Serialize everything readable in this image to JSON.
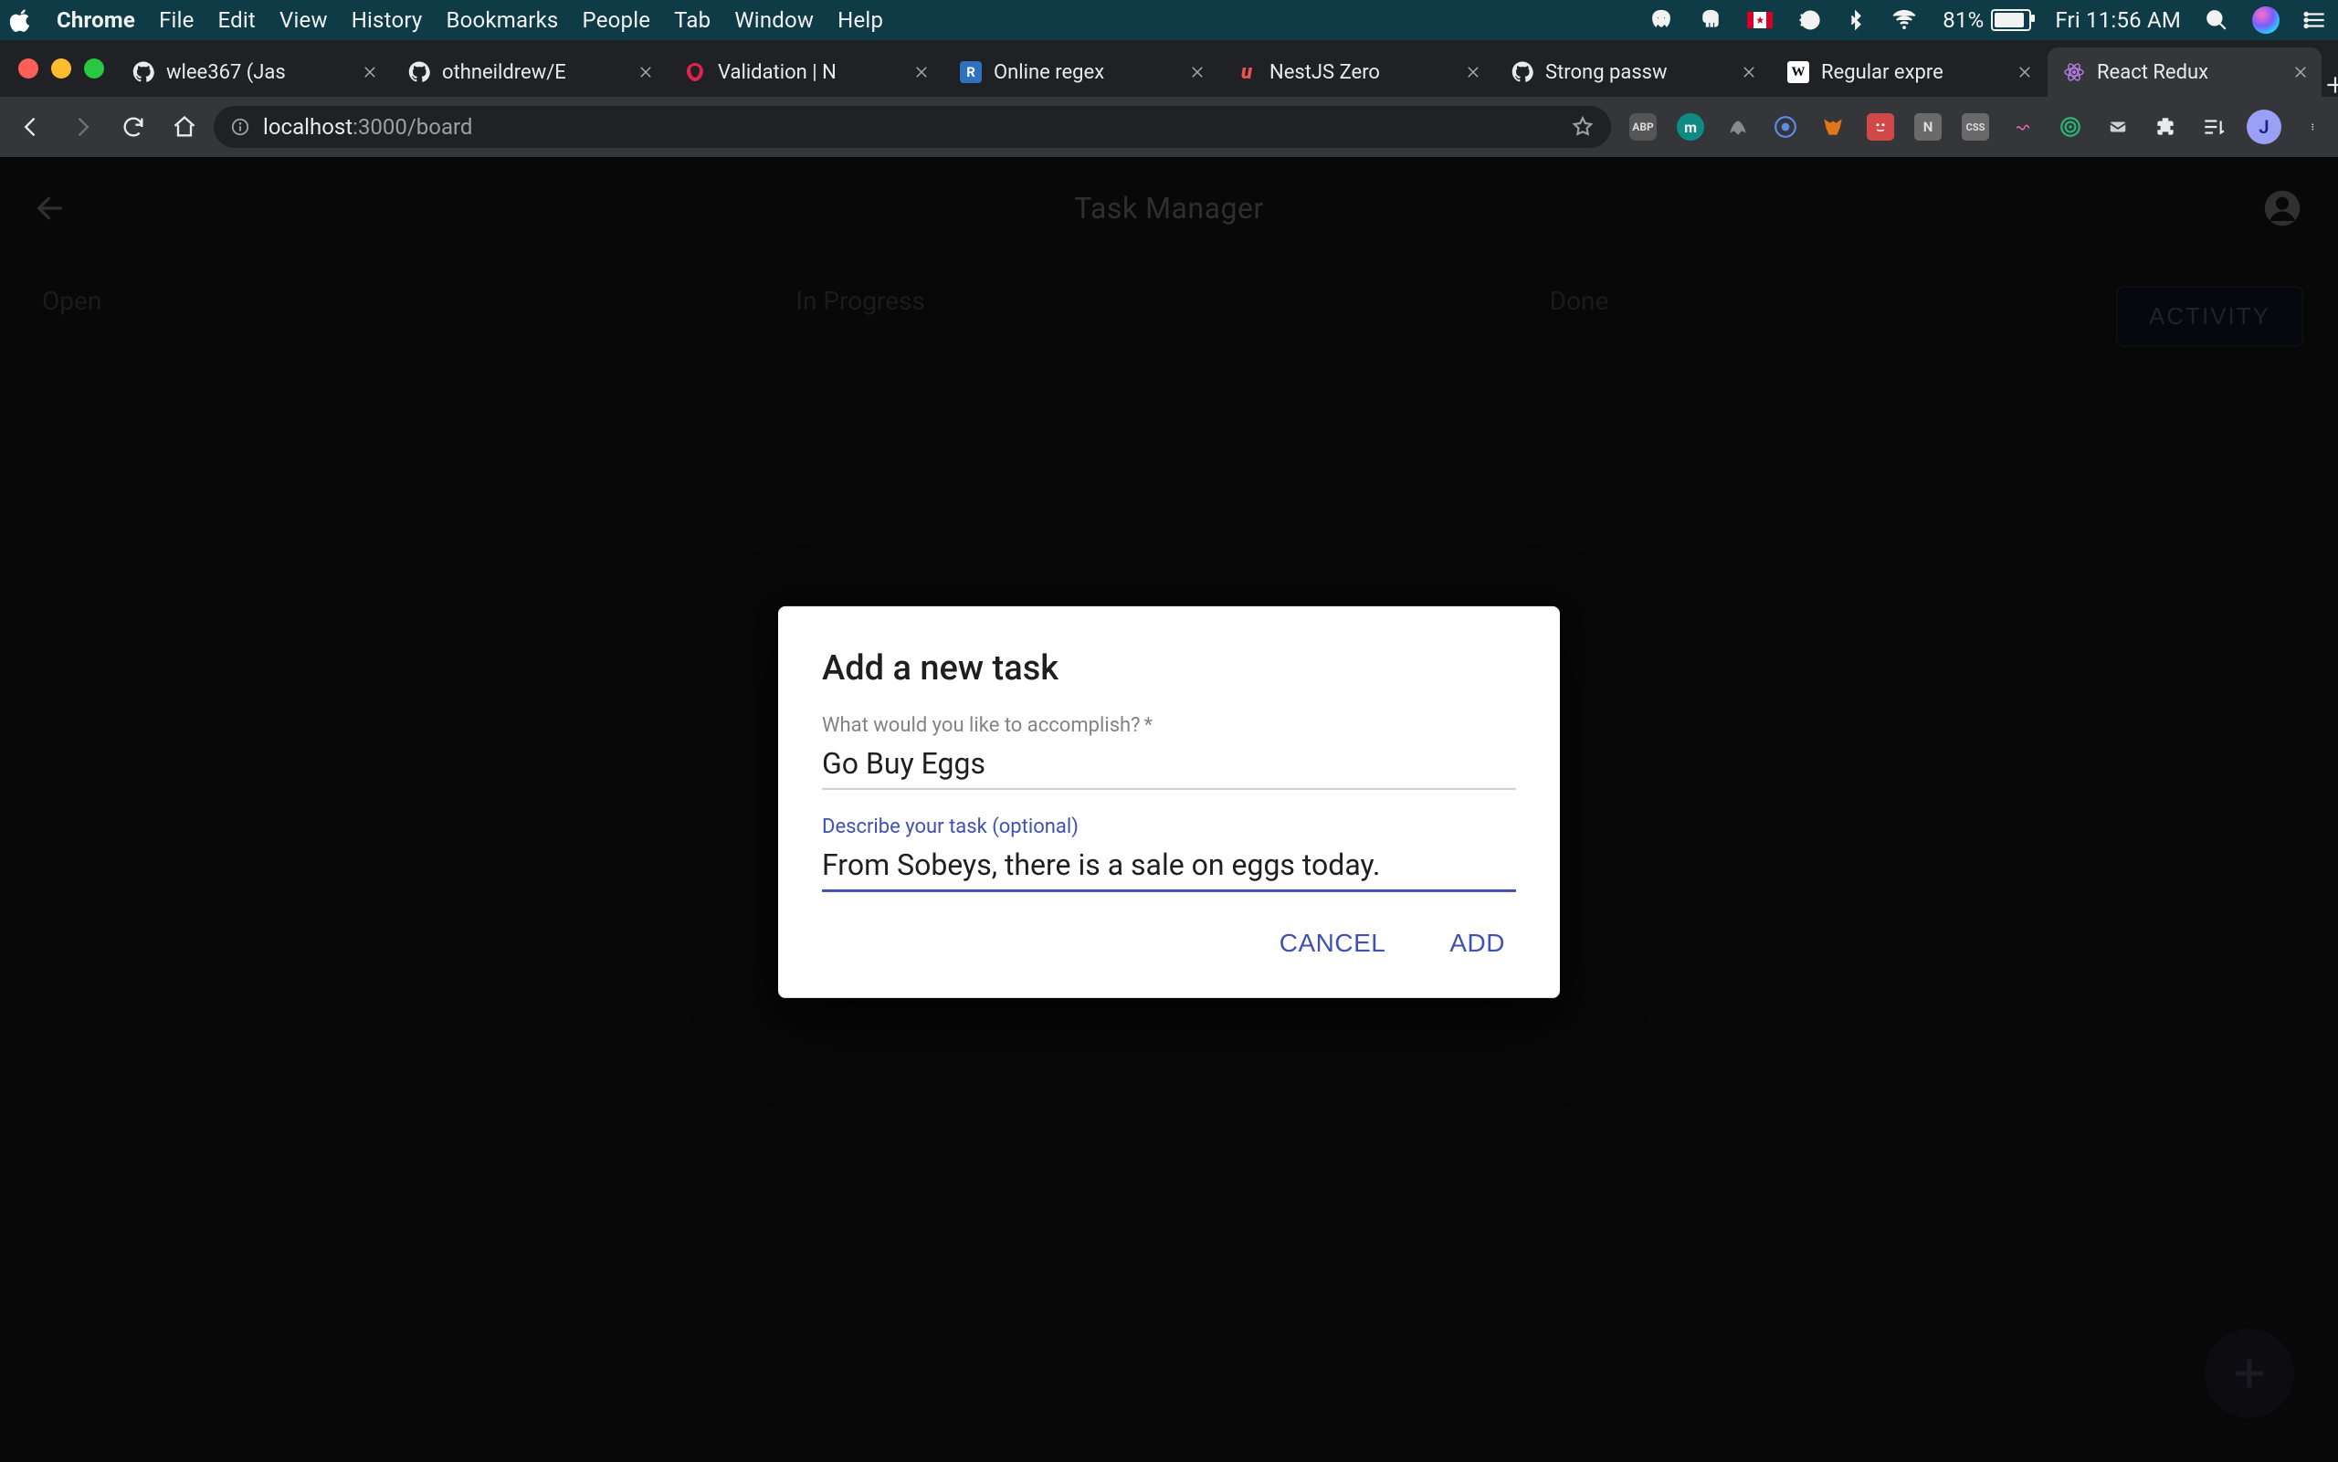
{
  "menubar": {
    "app": "Chrome",
    "items": [
      "File",
      "Edit",
      "View",
      "History",
      "Bookmarks",
      "People",
      "Tab",
      "Window",
      "Help"
    ],
    "battery_pct": "81%",
    "clock": "Fri 11:56 AM"
  },
  "browser": {
    "tabs": [
      {
        "favicon": "github",
        "title": "wlee367 (Jas"
      },
      {
        "favicon": "github",
        "title": "othneildrew/E"
      },
      {
        "favicon": "nest",
        "title": "Validation | N"
      },
      {
        "favicon": "rcube",
        "title": "Online regex"
      },
      {
        "favicon": "udemy",
        "title": "NestJS Zero"
      },
      {
        "favicon": "github",
        "title": "Strong passw"
      },
      {
        "favicon": "wiki",
        "title": "Regular expre"
      },
      {
        "favicon": "react",
        "title": "React Redux",
        "active": true
      }
    ],
    "url_host": "localhost",
    "url_rest": ":3000/board",
    "avatar_initial": "J"
  },
  "app": {
    "header_title": "Task Manager",
    "activity_label": "ACTIVITY",
    "columns": [
      "Open",
      "In Progress",
      "Done"
    ]
  },
  "dialog": {
    "title": "Add a new task",
    "field1_label": "What would you like to accomplish?",
    "field1_required": "*",
    "field1_value": "Go Buy Eggs",
    "field2_label": "Describe your task (optional)",
    "field2_value": "From Sobeys, there is a sale on eggs today.",
    "cancel_label": "CANCEL",
    "add_label": "ADD"
  }
}
